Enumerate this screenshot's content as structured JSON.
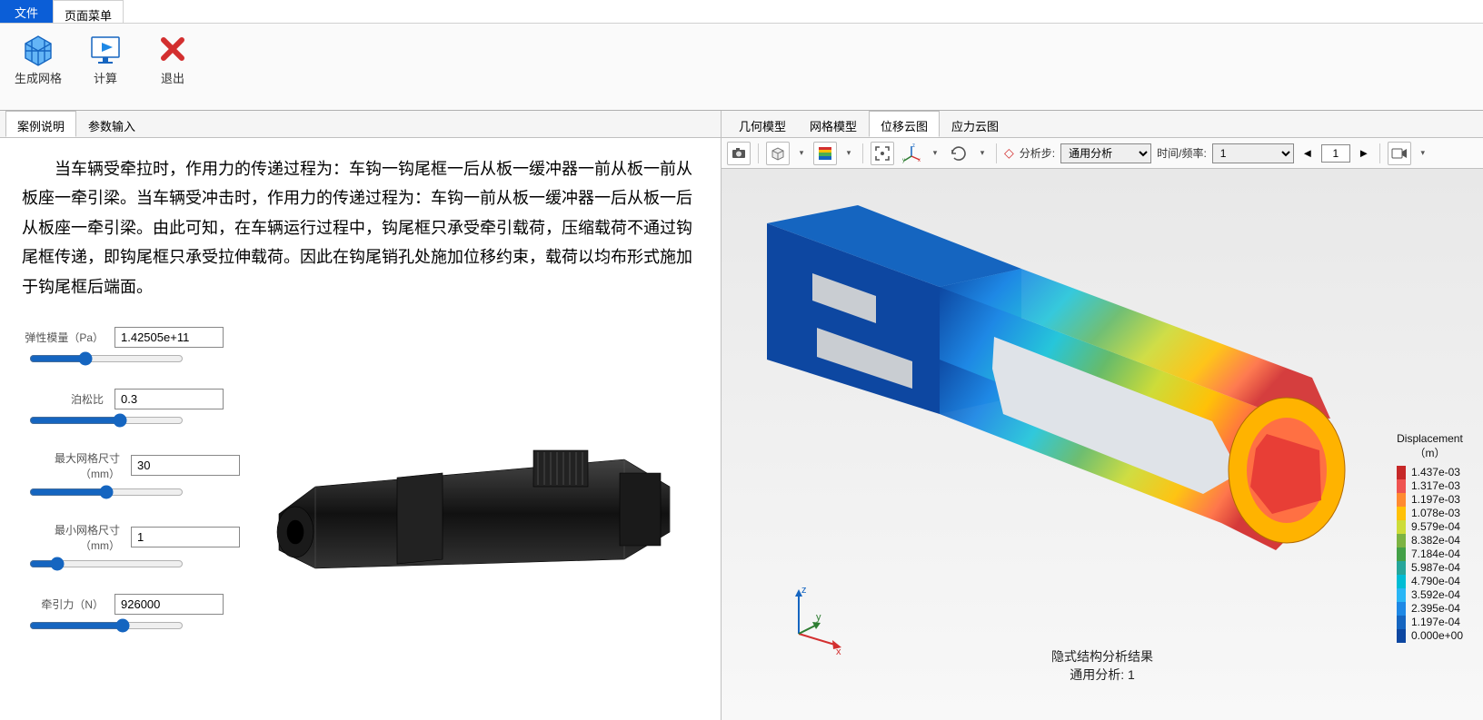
{
  "menubar": {
    "file": "文件",
    "page_menu": "页面菜单"
  },
  "ribbon": {
    "mesh": "生成网格",
    "compute": "计算",
    "exit": "退出"
  },
  "left_tabs": {
    "case_desc": "案例说明",
    "param_input": "参数输入"
  },
  "description": "当车辆受牵拉时，作用力的传递过程为：车钩一钩尾框一后从板一缓冲器一前从板一前从板座一牵引梁。当车辆受冲击时，作用力的传递过程为：车钩一前从板一缓冲器一后从板一后从板座一牵引梁。由此可知，在车辆运行过程中，钩尾框只承受牵引载荷，压缩载荷不通过钩尾框传递，即钩尾框只承受拉伸载荷。因此在钩尾销孔处施加位移约束，载荷以均布形式施加于钩尾框后端面。",
  "params": {
    "elastic_modulus": {
      "label": "弹性模量（Pa）",
      "value": "1.42505e+11"
    },
    "poisson": {
      "label": "泊松比",
      "value": "0.3"
    },
    "max_mesh": {
      "label": "最大网格尺寸（mm）",
      "value": "30"
    },
    "min_mesh": {
      "label": "最小网格尺寸（mm）",
      "value": "1"
    },
    "traction": {
      "label": "牵引力（N）",
      "value": "926000"
    }
  },
  "right_tabs": {
    "geom": "几何模型",
    "mesh": "网格模型",
    "disp": "位移云图",
    "stress": "应力云图"
  },
  "rtoolbar": {
    "step_label": "分析步:",
    "step_select": "通用分析",
    "time_label": "时间/频率:",
    "time_select": "1",
    "frame_value": "1"
  },
  "viewport": {
    "result_line1": "隐式结构分析结果",
    "result_line2": "通用分析: 1",
    "axis_x": "x",
    "axis_y": "y",
    "axis_z": "z"
  },
  "legend": {
    "title1": "Displacement",
    "title2": "（m）",
    "entries": [
      {
        "c": "#c62828",
        "v": "1.437e-03"
      },
      {
        "c": "#ef5350",
        "v": "1.317e-03"
      },
      {
        "c": "#ff8a30",
        "v": "1.197e-03"
      },
      {
        "c": "#ffc107",
        "v": "1.078e-03"
      },
      {
        "c": "#cddc39",
        "v": "9.579e-04"
      },
      {
        "c": "#7cb342",
        "v": "8.382e-04"
      },
      {
        "c": "#43a047",
        "v": "7.184e-04"
      },
      {
        "c": "#26a69a",
        "v": "5.987e-04"
      },
      {
        "c": "#00bcd4",
        "v": "4.790e-04"
      },
      {
        "c": "#29b6f6",
        "v": "3.592e-04"
      },
      {
        "c": "#1e88e5",
        "v": "2.395e-04"
      },
      {
        "c": "#1565c0",
        "v": "1.197e-04"
      },
      {
        "c": "#0d47a1",
        "v": "0.000e+00"
      }
    ]
  }
}
